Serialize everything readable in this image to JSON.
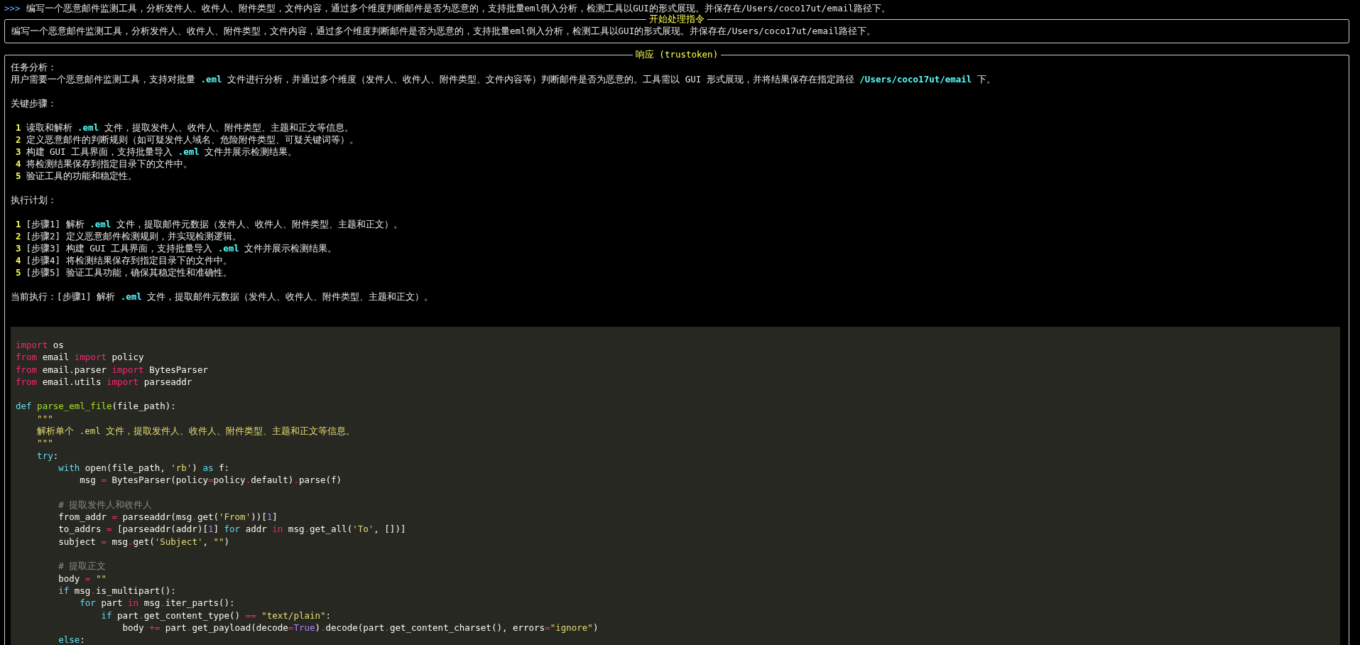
{
  "prompt": {
    "marker": ">>>",
    "text": "编写一个恶意邮件监测工具，分析发件人、收件人、附件类型，文件内容，通过多个维度判断邮件是否为恶意的，支持批量eml倒入分析，检测工具以GUI的形式展现。并保存在/Users/coco17ut/email路径下。"
  },
  "instruction_panel": {
    "title": "开始处理指令",
    "text": "编写一个恶意邮件监测工具，分析发件人、收件人、附件类型，文件内容，通过多个维度判断邮件是否为恶意的，支持批量eml倒入分析，检测工具以GUI的形式展现。并保存在/Users/coco17ut/email路径下。"
  },
  "response_panel": {
    "title": "响应 (trustoken)",
    "blocks": [
      {
        "kind": "text",
        "text": "任务分析："
      },
      {
        "kind": "text",
        "text": "用户需要一个恶意邮件监测工具，支持对批量 **.eml** 文件进行分析，并通过多个维度（发件人、收件人、附件类型、文件内容等）判断邮件是否为恶意的。工具需以 GUI 形式展现，并将结果保存在指定路径 **/Users/coco17ut/email** 下。"
      },
      {
        "kind": "blank"
      },
      {
        "kind": "text",
        "text": "关键步骤："
      },
      {
        "kind": "blank"
      },
      {
        "kind": "step",
        "number": "1",
        "text": "读取和解析 **.eml** 文件，提取发件人、收件人、附件类型、主题和正文等信息。"
      },
      {
        "kind": "step",
        "number": "2",
        "text": "定义恶意邮件的判断规则（如可疑发件人域名、危险附件类型、可疑关键词等）。"
      },
      {
        "kind": "step",
        "number": "3",
        "text": "构建 GUI 工具界面，支持批量导入 **.eml** 文件并展示检测结果。"
      },
      {
        "kind": "step",
        "number": "4",
        "text": "将检测结果保存到指定目录下的文件中。"
      },
      {
        "kind": "step",
        "number": "5",
        "text": "验证工具的功能和稳定性。"
      },
      {
        "kind": "blank"
      },
      {
        "kind": "text",
        "text": "执行计划："
      },
      {
        "kind": "blank"
      },
      {
        "kind": "step",
        "number": "1",
        "text": "[步骤1] 解析 **.eml** 文件，提取邮件元数据（发件人、收件人、附件类型、主题和正文）。"
      },
      {
        "kind": "step",
        "number": "2",
        "text": "[步骤2] 定义恶意邮件检测规则，并实现检测逻辑。"
      },
      {
        "kind": "step",
        "number": "3",
        "text": "[步骤3] 构建 GUI 工具界面，支持批量导入 **.eml** 文件并展示检测结果。"
      },
      {
        "kind": "step",
        "number": "4",
        "text": "[步骤4] 将检测结果保存到指定目录下的文件中。"
      },
      {
        "kind": "step",
        "number": "5",
        "text": "[步骤5] 验证工具功能，确保其稳定性和准确性。"
      },
      {
        "kind": "blank"
      },
      {
        "kind": "text",
        "text": "当前执行：[步骤1] 解析 **.eml** 文件，提取邮件元数据（发件人、收件人、附件类型、主题和正文）。"
      }
    ],
    "code_lines": [
      {
        "kind": "code",
        "tokens": [
          {
            "kind": "keyword",
            "text": "import"
          },
          {
            "kind": "plain",
            "text": " os"
          }
        ]
      },
      {
        "kind": "code",
        "tokens": [
          {
            "kind": "keyword",
            "text": "from"
          },
          {
            "kind": "plain",
            "text": " email "
          },
          {
            "kind": "keyword",
            "text": "import"
          },
          {
            "kind": "plain",
            "text": " policy"
          }
        ]
      },
      {
        "kind": "code",
        "tokens": [
          {
            "kind": "keyword",
            "text": "from"
          },
          {
            "kind": "plain",
            "text": " email.parser "
          },
          {
            "kind": "keyword",
            "text": "import"
          },
          {
            "kind": "plain",
            "text": " BytesParser"
          }
        ]
      },
      {
        "kind": "code",
        "tokens": [
          {
            "kind": "keyword",
            "text": "from"
          },
          {
            "kind": "plain",
            "text": " email.utils "
          },
          {
            "kind": "keyword",
            "text": "import"
          },
          {
            "kind": "plain",
            "text": " parseaddr"
          }
        ]
      },
      {
        "kind": "blank"
      },
      {
        "kind": "code",
        "tokens": [
          {
            "kind": "storage",
            "text": "def "
          },
          {
            "kind": "function",
            "text": "parse_eml_file"
          },
          {
            "kind": "plain",
            "text": "(file_path):"
          }
        ]
      },
      {
        "kind": "code",
        "tokens": [
          {
            "kind": "string",
            "text": "    \"\"\""
          }
        ]
      },
      {
        "kind": "code",
        "tokens": [
          {
            "kind": "string",
            "text": "    解析单个 .eml 文件，提取发件人、收件人、附件类型、主题和正文等信息。"
          }
        ]
      },
      {
        "kind": "code",
        "tokens": [
          {
            "kind": "string",
            "text": "    \"\"\""
          }
        ]
      },
      {
        "kind": "code",
        "tokens": [
          {
            "kind": "storage",
            "text": "    try"
          },
          {
            "kind": "plain",
            "text": ":"
          }
        ]
      },
      {
        "kind": "code",
        "tokens": [
          {
            "kind": "storage",
            "text": "        with"
          },
          {
            "kind": "plain",
            "text": " open(file_path, "
          },
          {
            "kind": "string",
            "text": "'rb'"
          },
          {
            "kind": "plain",
            "text": ") "
          },
          {
            "kind": "storage",
            "text": "as"
          },
          {
            "kind": "plain",
            "text": " f:"
          }
        ]
      },
      {
        "kind": "code",
        "tokens": [
          {
            "kind": "plain",
            "text": "            msg "
          },
          {
            "kind": "operator",
            "text": "="
          },
          {
            "kind": "plain",
            "text": " BytesParser(policy"
          },
          {
            "kind": "operator",
            "text": "="
          },
          {
            "kind": "plain",
            "text": "policy"
          },
          {
            "kind": "operator",
            "text": "."
          },
          {
            "kind": "plain",
            "text": "default)"
          },
          {
            "kind": "operator",
            "text": "."
          },
          {
            "kind": "plain",
            "text": "parse(f)"
          }
        ]
      },
      {
        "kind": "blank"
      },
      {
        "kind": "code",
        "tokens": [
          {
            "kind": "comment",
            "text": "        # 提取发件人和收件人"
          }
        ]
      },
      {
        "kind": "code",
        "tokens": [
          {
            "kind": "plain",
            "text": "        from_addr "
          },
          {
            "kind": "operator",
            "text": "="
          },
          {
            "kind": "plain",
            "text": " parseaddr(msg"
          },
          {
            "kind": "operator",
            "text": "."
          },
          {
            "kind": "plain",
            "text": "get("
          },
          {
            "kind": "string",
            "text": "'From'"
          },
          {
            "kind": "plain",
            "text": "))["
          },
          {
            "kind": "number",
            "text": "1"
          },
          {
            "kind": "plain",
            "text": "]"
          }
        ]
      },
      {
        "kind": "code",
        "tokens": [
          {
            "kind": "plain",
            "text": "        to_addrs "
          },
          {
            "kind": "operator",
            "text": "="
          },
          {
            "kind": "plain",
            "text": " [parseaddr(addr)["
          },
          {
            "kind": "number",
            "text": "1"
          },
          {
            "kind": "plain",
            "text": "] "
          },
          {
            "kind": "storage",
            "text": "for"
          },
          {
            "kind": "plain",
            "text": " addr "
          },
          {
            "kind": "keyword",
            "text": "in"
          },
          {
            "kind": "plain",
            "text": " msg"
          },
          {
            "kind": "operator",
            "text": "."
          },
          {
            "kind": "plain",
            "text": "get_all("
          },
          {
            "kind": "string",
            "text": "'To'"
          },
          {
            "kind": "plain",
            "text": ", [])]"
          }
        ]
      },
      {
        "kind": "code",
        "tokens": [
          {
            "kind": "plain",
            "text": "        subject "
          },
          {
            "kind": "operator",
            "text": "="
          },
          {
            "kind": "plain",
            "text": " msg"
          },
          {
            "kind": "operator",
            "text": "."
          },
          {
            "kind": "plain",
            "text": "get("
          },
          {
            "kind": "string",
            "text": "'Subject'"
          },
          {
            "kind": "plain",
            "text": ", "
          },
          {
            "kind": "string",
            "text": "\"\""
          },
          {
            "kind": "plain",
            "text": ")"
          }
        ]
      },
      {
        "kind": "blank"
      },
      {
        "kind": "code",
        "tokens": [
          {
            "kind": "comment",
            "text": "        # 提取正文"
          }
        ]
      },
      {
        "kind": "code",
        "tokens": [
          {
            "kind": "plain",
            "text": "        body "
          },
          {
            "kind": "operator",
            "text": "="
          },
          {
            "kind": "string",
            "text": " \"\""
          }
        ]
      },
      {
        "kind": "code",
        "tokens": [
          {
            "kind": "storage",
            "text": "        if"
          },
          {
            "kind": "plain",
            "text": " msg"
          },
          {
            "kind": "operator",
            "text": "."
          },
          {
            "kind": "plain",
            "text": "is_multipart():"
          }
        ]
      },
      {
        "kind": "code",
        "tokens": [
          {
            "kind": "storage",
            "text": "            for"
          },
          {
            "kind": "plain",
            "text": " part "
          },
          {
            "kind": "keyword",
            "text": "in"
          },
          {
            "kind": "plain",
            "text": " msg"
          },
          {
            "kind": "operator",
            "text": "."
          },
          {
            "kind": "plain",
            "text": "iter_parts():"
          }
        ]
      },
      {
        "kind": "code",
        "tokens": [
          {
            "kind": "storage",
            "text": "                if"
          },
          {
            "kind": "plain",
            "text": " part"
          },
          {
            "kind": "operator",
            "text": "."
          },
          {
            "kind": "plain",
            "text": "get_content_type() "
          },
          {
            "kind": "operator",
            "text": "=="
          },
          {
            "kind": "string",
            "text": " \"text/plain\""
          },
          {
            "kind": "plain",
            "text": ":"
          }
        ]
      },
      {
        "kind": "code",
        "tokens": [
          {
            "kind": "plain",
            "text": "                    body "
          },
          {
            "kind": "operator",
            "text": "+="
          },
          {
            "kind": "plain",
            "text": " part"
          },
          {
            "kind": "operator",
            "text": "."
          },
          {
            "kind": "plain",
            "text": "get_payload(decode"
          },
          {
            "kind": "operator",
            "text": "="
          },
          {
            "kind": "number",
            "text": "True"
          },
          {
            "kind": "plain",
            "text": ")"
          },
          {
            "kind": "operator",
            "text": "."
          },
          {
            "kind": "plain",
            "text": "decode(part"
          },
          {
            "kind": "operator",
            "text": "."
          },
          {
            "kind": "plain",
            "text": "get_content_charset(), errors"
          },
          {
            "kind": "operator",
            "text": "="
          },
          {
            "kind": "string",
            "text": "\"ignore\""
          },
          {
            "kind": "plain",
            "text": ")"
          }
        ]
      },
      {
        "kind": "code",
        "tokens": [
          {
            "kind": "storage",
            "text": "        else"
          },
          {
            "kind": "plain",
            "text": ":"
          }
        ]
      }
    ]
  }
}
